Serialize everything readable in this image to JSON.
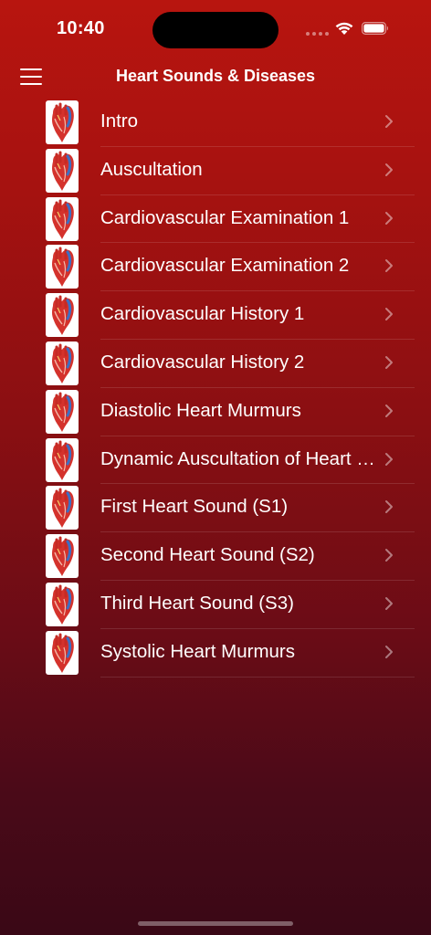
{
  "status_bar": {
    "time": "10:40"
  },
  "nav": {
    "title": "Heart Sounds & Diseases",
    "menu_icon": "hamburger-menu-icon"
  },
  "list": {
    "thumbnail_icon": "anatomical-heart-icon",
    "chevron_icon": "chevron-right-icon",
    "items": [
      {
        "label": "Intro"
      },
      {
        "label": "Auscultation"
      },
      {
        "label": "Cardiovascular Examination 1"
      },
      {
        "label": "Cardiovascular Examination 2"
      },
      {
        "label": "Cardiovascular History 1"
      },
      {
        "label": "Cardiovascular History 2"
      },
      {
        "label": "Diastolic Heart Murmurs"
      },
      {
        "label": "Dynamic Auscultation of Heart Murmurs"
      },
      {
        "label": "First Heart Sound (S1)"
      },
      {
        "label": "Second Heart Sound (S2)"
      },
      {
        "label": "Third Heart Sound (S3)"
      },
      {
        "label": "Systolic Heart Murmurs"
      }
    ]
  },
  "colors": {
    "bg_top": "#b8150f",
    "bg_bottom": "#3a0816",
    "text": "#ffffff"
  }
}
